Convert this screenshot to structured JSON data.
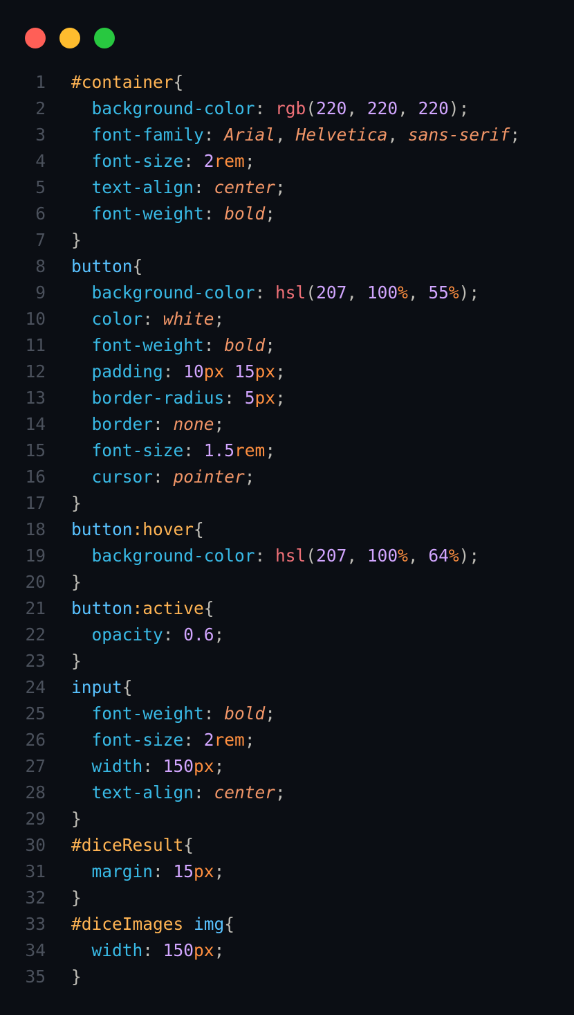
{
  "window": {
    "controls": [
      {
        "name": "close",
        "color": "#ff5f57"
      },
      {
        "name": "minimize",
        "color": "#febc2e"
      },
      {
        "name": "maximize",
        "color": "#28c840"
      }
    ]
  },
  "code": {
    "language": "css",
    "lines": [
      [
        [
          "selid",
          "#container"
        ],
        [
          "punct",
          "{"
        ]
      ],
      [
        [
          "prop",
          "  background-color"
        ],
        [
          "punct",
          ": "
        ],
        [
          "func",
          "rgb"
        ],
        [
          "punct",
          "("
        ],
        [
          "num",
          "220"
        ],
        [
          "punct",
          ", "
        ],
        [
          "num",
          "220"
        ],
        [
          "punct",
          ", "
        ],
        [
          "num",
          "220"
        ],
        [
          "punct",
          ");"
        ]
      ],
      [
        [
          "prop",
          "  font-family"
        ],
        [
          "punct",
          ": "
        ],
        [
          "kw",
          "Arial"
        ],
        [
          "punct",
          ", "
        ],
        [
          "kw",
          "Helvetica"
        ],
        [
          "punct",
          ", "
        ],
        [
          "kw",
          "sans-serif"
        ],
        [
          "punct",
          ";"
        ]
      ],
      [
        [
          "prop",
          "  font-size"
        ],
        [
          "punct",
          ": "
        ],
        [
          "num",
          "2"
        ],
        [
          "unit",
          "rem"
        ],
        [
          "punct",
          ";"
        ]
      ],
      [
        [
          "prop",
          "  text-align"
        ],
        [
          "punct",
          ": "
        ],
        [
          "kw",
          "center"
        ],
        [
          "punct",
          ";"
        ]
      ],
      [
        [
          "prop",
          "  font-weight"
        ],
        [
          "punct",
          ": "
        ],
        [
          "kw",
          "bold"
        ],
        [
          "punct",
          ";"
        ]
      ],
      [
        [
          "punct",
          "}"
        ]
      ],
      [
        [
          "seltag",
          "button"
        ],
        [
          "punct",
          "{"
        ]
      ],
      [
        [
          "prop",
          "  background-color"
        ],
        [
          "punct",
          ": "
        ],
        [
          "func",
          "hsl"
        ],
        [
          "punct",
          "("
        ],
        [
          "num",
          "207"
        ],
        [
          "punct",
          ", "
        ],
        [
          "num",
          "100"
        ],
        [
          "unit",
          "%"
        ],
        [
          "punct",
          ", "
        ],
        [
          "num",
          "55"
        ],
        [
          "unit",
          "%"
        ],
        [
          "punct",
          ");"
        ]
      ],
      [
        [
          "prop",
          "  color"
        ],
        [
          "punct",
          ": "
        ],
        [
          "kw",
          "white"
        ],
        [
          "punct",
          ";"
        ]
      ],
      [
        [
          "prop",
          "  font-weight"
        ],
        [
          "punct",
          ": "
        ],
        [
          "kw",
          "bold"
        ],
        [
          "punct",
          ";"
        ]
      ],
      [
        [
          "prop",
          "  padding"
        ],
        [
          "punct",
          ": "
        ],
        [
          "num",
          "10"
        ],
        [
          "unit",
          "px"
        ],
        [
          "punct",
          " "
        ],
        [
          "num",
          "15"
        ],
        [
          "unit",
          "px"
        ],
        [
          "punct",
          ";"
        ]
      ],
      [
        [
          "prop",
          "  border-radius"
        ],
        [
          "punct",
          ": "
        ],
        [
          "num",
          "5"
        ],
        [
          "unit",
          "px"
        ],
        [
          "punct",
          ";"
        ]
      ],
      [
        [
          "prop",
          "  border"
        ],
        [
          "punct",
          ": "
        ],
        [
          "kw",
          "none"
        ],
        [
          "punct",
          ";"
        ]
      ],
      [
        [
          "prop",
          "  font-size"
        ],
        [
          "punct",
          ": "
        ],
        [
          "num",
          "1.5"
        ],
        [
          "unit",
          "rem"
        ],
        [
          "punct",
          ";"
        ]
      ],
      [
        [
          "prop",
          "  cursor"
        ],
        [
          "punct",
          ": "
        ],
        [
          "kw",
          "pointer"
        ],
        [
          "punct",
          ";"
        ]
      ],
      [
        [
          "punct",
          "}"
        ]
      ],
      [
        [
          "seltag",
          "button"
        ],
        [
          "pseudo",
          ":hover"
        ],
        [
          "punct",
          "{"
        ]
      ],
      [
        [
          "prop",
          "  background-color"
        ],
        [
          "punct",
          ": "
        ],
        [
          "func",
          "hsl"
        ],
        [
          "punct",
          "("
        ],
        [
          "num",
          "207"
        ],
        [
          "punct",
          ", "
        ],
        [
          "num",
          "100"
        ],
        [
          "unit",
          "%"
        ],
        [
          "punct",
          ", "
        ],
        [
          "num",
          "64"
        ],
        [
          "unit",
          "%"
        ],
        [
          "punct",
          ");"
        ]
      ],
      [
        [
          "punct",
          "}"
        ]
      ],
      [
        [
          "seltag",
          "button"
        ],
        [
          "pseudo",
          ":active"
        ],
        [
          "punct",
          "{"
        ]
      ],
      [
        [
          "prop",
          "  opacity"
        ],
        [
          "punct",
          ": "
        ],
        [
          "num",
          "0.6"
        ],
        [
          "punct",
          ";"
        ]
      ],
      [
        [
          "punct",
          "}"
        ]
      ],
      [
        [
          "seltag",
          "input"
        ],
        [
          "punct",
          "{"
        ]
      ],
      [
        [
          "prop",
          "  font-weight"
        ],
        [
          "punct",
          ": "
        ],
        [
          "kw",
          "bold"
        ],
        [
          "punct",
          ";"
        ]
      ],
      [
        [
          "prop",
          "  font-size"
        ],
        [
          "punct",
          ": "
        ],
        [
          "num",
          "2"
        ],
        [
          "unit",
          "rem"
        ],
        [
          "punct",
          ";"
        ]
      ],
      [
        [
          "prop",
          "  width"
        ],
        [
          "punct",
          ": "
        ],
        [
          "num",
          "150"
        ],
        [
          "unit",
          "px"
        ],
        [
          "punct",
          ";"
        ]
      ],
      [
        [
          "prop",
          "  text-align"
        ],
        [
          "punct",
          ": "
        ],
        [
          "kw",
          "center"
        ],
        [
          "punct",
          ";"
        ]
      ],
      [
        [
          "punct",
          "}"
        ]
      ],
      [
        [
          "selid",
          "#diceResult"
        ],
        [
          "punct",
          "{"
        ]
      ],
      [
        [
          "prop",
          "  margin"
        ],
        [
          "punct",
          ": "
        ],
        [
          "num",
          "15"
        ],
        [
          "unit",
          "px"
        ],
        [
          "punct",
          ";"
        ]
      ],
      [
        [
          "punct",
          "}"
        ]
      ],
      [
        [
          "selid",
          "#diceImages"
        ],
        [
          "punct",
          " "
        ],
        [
          "seltag",
          "img"
        ],
        [
          "punct",
          "{"
        ]
      ],
      [
        [
          "prop",
          "  width"
        ],
        [
          "punct",
          ": "
        ],
        [
          "num",
          "150"
        ],
        [
          "unit",
          "px"
        ],
        [
          "punct",
          ";"
        ]
      ],
      [
        [
          "punct",
          "}"
        ]
      ]
    ]
  }
}
